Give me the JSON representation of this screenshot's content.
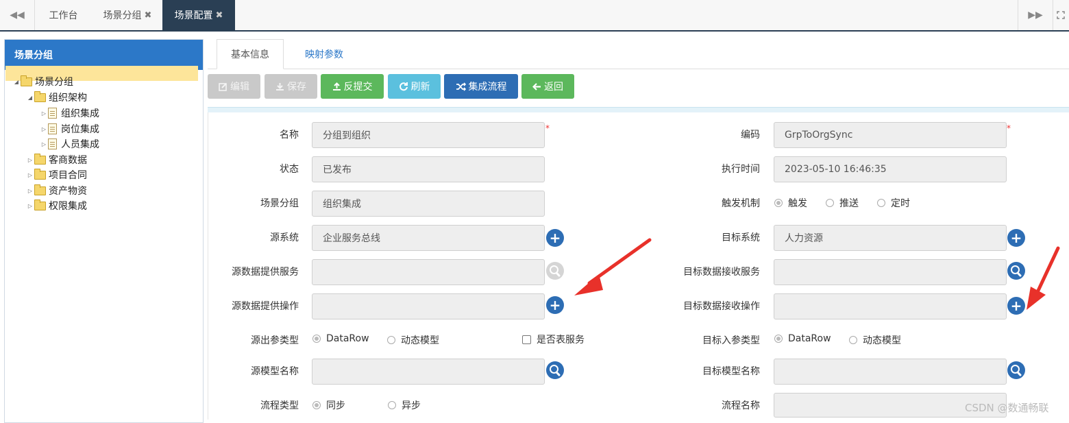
{
  "top_tabs": [
    {
      "label": "工作台",
      "closable": false,
      "active": false
    },
    {
      "label": "场景分组",
      "closable": true,
      "active": false
    },
    {
      "label": "场景配置",
      "closable": true,
      "active": true
    }
  ],
  "icons": {
    "nav_prev": "◀◀",
    "nav_next": "▶▶",
    "close": "✖"
  },
  "left_panel": {
    "title": "场景分组",
    "tree": [
      {
        "label": "场景分组",
        "level": 0,
        "type": "folder",
        "expanded": true
      },
      {
        "label": "组织架构",
        "level": 1,
        "type": "folder",
        "expanded": true
      },
      {
        "label": "组织集成",
        "level": 2,
        "type": "doc",
        "selected": true
      },
      {
        "label": "岗位集成",
        "level": 2,
        "type": "doc"
      },
      {
        "label": "人员集成",
        "level": 2,
        "type": "doc"
      },
      {
        "label": "客商数据",
        "level": 1,
        "type": "folder"
      },
      {
        "label": "项目合同",
        "level": 1,
        "type": "folder"
      },
      {
        "label": "资产物资",
        "level": 1,
        "type": "folder"
      },
      {
        "label": "权限集成",
        "level": 1,
        "type": "folder"
      }
    ]
  },
  "content_tabs": {
    "basic": "基本信息",
    "mapping": "映射参数"
  },
  "toolbar": {
    "edit": "编辑",
    "save": "保存",
    "unsubmit": "反提交",
    "refresh": "刷新",
    "flow": "集成流程",
    "back": "返回"
  },
  "form": {
    "name": {
      "label": "名称",
      "value": "分组到组织"
    },
    "code": {
      "label": "编码",
      "value": "GrpToOrgSync"
    },
    "status": {
      "label": "状态",
      "value": "已发布"
    },
    "exec_time": {
      "label": "执行时间",
      "value": "2023-05-10 16:46:35"
    },
    "scene_group": {
      "label": "场景分组",
      "value": "组织集成"
    },
    "trigger": {
      "label": "触发机制",
      "options": [
        "触发",
        "推送",
        "定时"
      ],
      "selected": "触发"
    },
    "source_system": {
      "label": "源系统",
      "value": "企业服务总线"
    },
    "target_system": {
      "label": "目标系统",
      "value": "人力资源"
    },
    "source_service": {
      "label": "源数据提供服务",
      "value": ""
    },
    "target_service": {
      "label": "目标数据接收服务",
      "value": ""
    },
    "source_op": {
      "label": "源数据提供操作",
      "value": ""
    },
    "target_op": {
      "label": "目标数据接收操作",
      "value": ""
    },
    "source_param_type": {
      "label": "源出参类型",
      "options": [
        "DataRow",
        "动态模型"
      ],
      "selected": "DataRow"
    },
    "is_table_service": {
      "label": "是否表服务",
      "checked": false
    },
    "target_param_type": {
      "label": "目标入参类型",
      "options": [
        "DataRow",
        "动态模型"
      ],
      "selected": "DataRow"
    },
    "source_model": {
      "label": "源模型名称",
      "value": ""
    },
    "target_model": {
      "label": "目标模型名称",
      "value": ""
    },
    "flow_type": {
      "label": "流程类型",
      "options": [
        "同步",
        "异步"
      ],
      "selected": "同步"
    },
    "flow_name": {
      "label": "流程名称",
      "value": ""
    }
  },
  "watermark": "CSDN @数通畅联",
  "colors": {
    "header_blue": "#2c78c8",
    "dark_tab": "#2a3f54",
    "green": "#5cb85c",
    "cyan": "#5bc0de",
    "blue": "#2d6db4",
    "arrow_red": "#e8312a"
  }
}
